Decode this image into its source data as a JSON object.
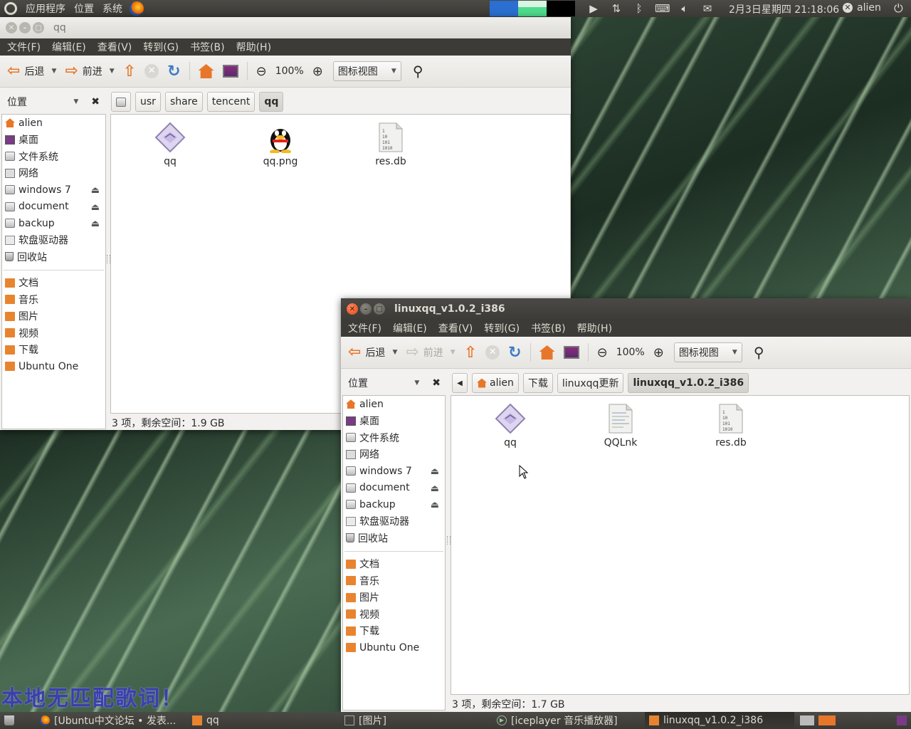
{
  "top_panel": {
    "menus": [
      "应用程序",
      "位置",
      "系统"
    ],
    "clock": "2月3日星期四 21:18:06",
    "user": "alien",
    "colors": {
      "monitor1": "#2a6fd1",
      "monitor2": "#4fdc8c",
      "monitor3": "#000000"
    }
  },
  "window_qq": {
    "title": "qq",
    "menu": [
      "文件(F)",
      "编辑(E)",
      "查看(V)",
      "转到(G)",
      "书签(B)",
      "帮助(H)"
    ],
    "toolbar": {
      "back": "后退",
      "forward": "前进",
      "zoom": "100%",
      "view_mode": "图标视图"
    },
    "places_label": "位置",
    "breadcrumbs": [
      "usr",
      "share",
      "tencent",
      "qq"
    ],
    "sidebar_devices": [
      {
        "label": "alien",
        "icon": "home-icon"
      },
      {
        "label": "桌面",
        "icon": "desktop-icon"
      },
      {
        "label": "文件系统",
        "icon": "drive-icon"
      },
      {
        "label": "网络",
        "icon": "network-icon"
      },
      {
        "label": "windows 7",
        "icon": "drive-icon",
        "eject": true
      },
      {
        "label": "document",
        "icon": "drive-icon",
        "eject": true
      },
      {
        "label": "backup",
        "icon": "drive-icon",
        "eject": true
      },
      {
        "label": "软盘驱动器",
        "icon": "floppy-icon"
      },
      {
        "label": "回收站",
        "icon": "trash-icon"
      }
    ],
    "sidebar_bookmarks": [
      "文档",
      "音乐",
      "图片",
      "视频",
      "下载",
      "Ubuntu One"
    ],
    "files": [
      "qq",
      "qq.png",
      "res.db"
    ],
    "status": "3 项，剩余空间：1.9 GB"
  },
  "window_linuxqq": {
    "title": "linuxqq_v1.0.2_i386",
    "menu": [
      "文件(F)",
      "编辑(E)",
      "查看(V)",
      "转到(G)",
      "书签(B)",
      "帮助(H)"
    ],
    "toolbar": {
      "back": "后退",
      "forward": "前进",
      "zoom": "100%",
      "view_mode": "图标视图"
    },
    "places_label": "位置",
    "breadcrumbs": [
      "alien",
      "下载",
      "linuxqq更新",
      "linuxqq_v1.0.2_i386"
    ],
    "sidebar_devices": [
      {
        "label": "alien",
        "icon": "home-icon"
      },
      {
        "label": "桌面",
        "icon": "desktop-icon"
      },
      {
        "label": "文件系统",
        "icon": "drive-icon"
      },
      {
        "label": "网络",
        "icon": "network-icon"
      },
      {
        "label": "windows 7",
        "icon": "drive-icon",
        "eject": true
      },
      {
        "label": "document",
        "icon": "drive-icon",
        "eject": true
      },
      {
        "label": "backup",
        "icon": "drive-icon",
        "eject": true
      },
      {
        "label": "软盘驱动器",
        "icon": "floppy-icon"
      },
      {
        "label": "回收站",
        "icon": "trash-icon"
      }
    ],
    "sidebar_bookmarks": [
      "文档",
      "音乐",
      "图片",
      "视频",
      "下载",
      "Ubuntu One"
    ],
    "files": [
      "qq",
      "QQLnk",
      "res.db"
    ],
    "status": "3 项，剩余空间：1.7 GB"
  },
  "desktop": {
    "lyrics": "本地无匹配歌词！"
  },
  "taskbar": {
    "tasks": [
      "[Ubuntu中文论坛 • 发表...",
      "qq",
      "[图片]",
      "[iceplayer 音乐播放器]",
      "linuxqq_v1.0.2_i386"
    ]
  }
}
